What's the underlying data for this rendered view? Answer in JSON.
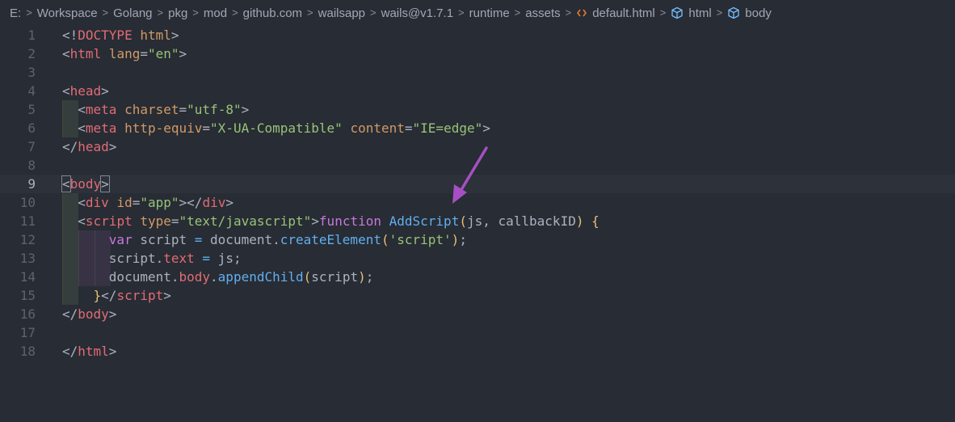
{
  "breadcrumb": {
    "items": [
      {
        "label": "E:",
        "icon": ""
      },
      {
        "label": "Workspace",
        "icon": ""
      },
      {
        "label": "Golang",
        "icon": ""
      },
      {
        "label": "pkg",
        "icon": ""
      },
      {
        "label": "mod",
        "icon": ""
      },
      {
        "label": "github.com",
        "icon": ""
      },
      {
        "label": "wailsapp",
        "icon": ""
      },
      {
        "label": "wails@v1.7.1",
        "icon": ""
      },
      {
        "label": "runtime",
        "icon": ""
      },
      {
        "label": "assets",
        "icon": ""
      },
      {
        "label": "default.html",
        "icon": "html-file-icon"
      },
      {
        "label": "html",
        "icon": "cube-symbol-icon"
      },
      {
        "label": "body",
        "icon": "cube-symbol-icon"
      }
    ],
    "separator": ">"
  },
  "editor": {
    "current_line": 9,
    "lines": [
      {
        "num": "1",
        "tokens": [
          [
            "pun",
            "<!"
          ],
          [
            "tag",
            "DOCTYPE"
          ],
          [
            "pun",
            " "
          ],
          [
            "att",
            "html"
          ],
          [
            "pun",
            ">"
          ]
        ]
      },
      {
        "num": "2",
        "tokens": [
          [
            "pun",
            "<"
          ],
          [
            "tag",
            "html"
          ],
          [
            "pun",
            " "
          ],
          [
            "att",
            "lang"
          ],
          [
            "pun",
            "="
          ],
          [
            "str",
            "\"en\""
          ],
          [
            "pun",
            ">"
          ]
        ]
      },
      {
        "num": "3",
        "tokens": []
      },
      {
        "num": "4",
        "tokens": [
          [
            "pun",
            "<"
          ],
          [
            "tag",
            "head"
          ],
          [
            "pun",
            ">"
          ]
        ]
      },
      {
        "num": "5",
        "tokens": [
          [
            "pun",
            "  <"
          ],
          [
            "tag",
            "meta"
          ],
          [
            "pun",
            " "
          ],
          [
            "att",
            "charset"
          ],
          [
            "pun",
            "="
          ],
          [
            "str",
            "\"utf-8\""
          ],
          [
            "pun",
            ">"
          ]
        ]
      },
      {
        "num": "6",
        "tokens": [
          [
            "pun",
            "  <"
          ],
          [
            "tag",
            "meta"
          ],
          [
            "pun",
            " "
          ],
          [
            "att",
            "http-equiv"
          ],
          [
            "pun",
            "="
          ],
          [
            "str",
            "\"X-UA-Compatible\""
          ],
          [
            "pun",
            " "
          ],
          [
            "att",
            "content"
          ],
          [
            "pun",
            "="
          ],
          [
            "str",
            "\"IE=edge\""
          ],
          [
            "pun",
            ">"
          ]
        ]
      },
      {
        "num": "7",
        "tokens": [
          [
            "pun",
            "</"
          ],
          [
            "tag",
            "head"
          ],
          [
            "pun",
            ">"
          ]
        ]
      },
      {
        "num": "8",
        "tokens": []
      },
      {
        "num": "9",
        "tokens": [
          [
            "pun",
            "<"
          ],
          [
            "tag",
            "body"
          ],
          [
            "pun",
            ">"
          ]
        ]
      },
      {
        "num": "10",
        "tokens": [
          [
            "pun",
            "  <"
          ],
          [
            "tag",
            "div"
          ],
          [
            "pun",
            " "
          ],
          [
            "att",
            "id"
          ],
          [
            "pun",
            "="
          ],
          [
            "str",
            "\"app\""
          ],
          [
            "pun",
            "></"
          ],
          [
            "tag",
            "div"
          ],
          [
            "pun",
            ">"
          ]
        ]
      },
      {
        "num": "11",
        "tokens": [
          [
            "pun",
            "  <"
          ],
          [
            "tag",
            "script"
          ],
          [
            "pun",
            " "
          ],
          [
            "att",
            "type"
          ],
          [
            "pun",
            "="
          ],
          [
            "str",
            "\"text/javascript\""
          ],
          [
            "pun",
            ">"
          ],
          [
            "kw",
            "function"
          ],
          [
            "pun",
            " "
          ],
          [
            "fn",
            "AddScript"
          ],
          [
            "brk",
            "("
          ],
          [
            "var",
            "js, callbackID"
          ],
          [
            "brk",
            ")"
          ],
          [
            "pun",
            " "
          ],
          [
            "brk",
            "{"
          ]
        ]
      },
      {
        "num": "12",
        "tokens": [
          [
            "pun",
            "      "
          ],
          [
            "kw",
            "var"
          ],
          [
            "var",
            " script "
          ],
          [
            "fn",
            "="
          ],
          [
            "var",
            " document."
          ],
          [
            "fn",
            "createElement"
          ],
          [
            "brk",
            "("
          ],
          [
            "str",
            "'script'"
          ],
          [
            "brk",
            ")"
          ],
          [
            "pun",
            ";"
          ]
        ]
      },
      {
        "num": "13",
        "tokens": [
          [
            "var",
            "      script."
          ],
          [
            "prop",
            "text"
          ],
          [
            "var",
            " "
          ],
          [
            "fn",
            "="
          ],
          [
            "var",
            " js;"
          ]
        ]
      },
      {
        "num": "14",
        "tokens": [
          [
            "var",
            "      document."
          ],
          [
            "prop",
            "body"
          ],
          [
            "var",
            "."
          ],
          [
            "fn",
            "appendChild"
          ],
          [
            "brk",
            "("
          ],
          [
            "var",
            "script"
          ],
          [
            "brk",
            ")"
          ],
          [
            "pun",
            ";"
          ]
        ]
      },
      {
        "num": "15",
        "tokens": [
          [
            "pun",
            "    "
          ],
          [
            "brk",
            "}"
          ],
          [
            "pun",
            "</"
          ],
          [
            "tag",
            "script"
          ],
          [
            "pun",
            ">"
          ]
        ]
      },
      {
        "num": "16",
        "tokens": [
          [
            "pun",
            "</"
          ],
          [
            "tag",
            "body"
          ],
          [
            "pun",
            ">"
          ]
        ]
      },
      {
        "num": "17",
        "tokens": []
      },
      {
        "num": "18",
        "tokens": [
          [
            "pun",
            "</"
          ],
          [
            "tag",
            "html"
          ],
          [
            "pun",
            ">"
          ]
        ]
      }
    ]
  },
  "annotation": {
    "arrow_color": "#a64fc4",
    "icon": "arrow-annotation-icon"
  },
  "colors": {
    "background": "#282c34",
    "current_line": "#2c313a",
    "tag": "#e06c75",
    "attribute": "#d19a66",
    "string": "#98c379",
    "keyword": "#c678dd",
    "function": "#61afef",
    "bracket": "#e5c07b"
  }
}
